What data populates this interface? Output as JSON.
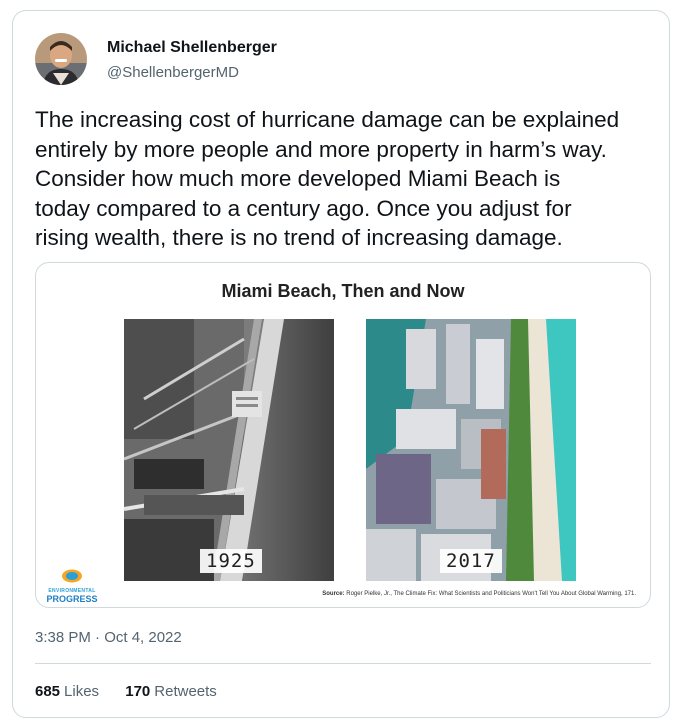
{
  "author": {
    "name": "Michael Shellenberger",
    "handle": "@ShellenbergerMD"
  },
  "tweet": {
    "text": "The increasing cost of hurricane damage can be explained\nentirely by more people and more property in harm’s way.\nConsider how much more developed Miami Beach is\ntoday compared to a century ago. Once you adjust for\nrising wealth, there is no trend of increasing damage."
  },
  "media": {
    "title": "Miami Beach, Then and Now",
    "left_year": "1925",
    "right_year": "2017",
    "logo_top": "ENVIRONMENTAL",
    "logo_bottom": "PROGRESS",
    "source_label": "Source:",
    "source_text": "Roger Pielke, Jr., The Climate Fix: What Scientists and Politicians Won't Tell You About Global Warming, 171."
  },
  "timestamp": "3:38 PM · Oct 4, 2022",
  "stats": {
    "likes_count": "685",
    "likes_label": "Likes",
    "retweets_count": "170",
    "retweets_label": "Retweets"
  },
  "colors": {
    "text": "#0f1419",
    "secondary": "#536471",
    "border": "#cfd9de"
  }
}
